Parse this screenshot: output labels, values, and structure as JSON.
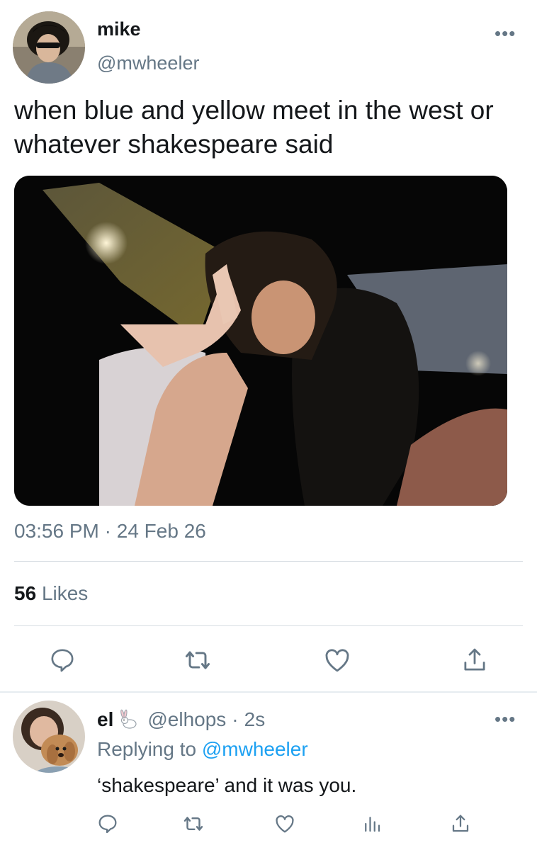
{
  "tweet": {
    "author_name": "mike",
    "author_handle": "@mwheeler",
    "text": "when blue and yellow meet in the west or whatever shakespeare said",
    "time": "03:56 PM",
    "separator": "·",
    "date": "24 Feb 26",
    "likes_count": "56",
    "likes_label": "Likes",
    "more_icon": "more-dots-icon",
    "actions": [
      "reply-icon",
      "retweet-icon",
      "like-icon",
      "share-icon"
    ]
  },
  "reply": {
    "author_name": "el",
    "author_emoji_icon": "rabbit-icon",
    "author_handle": "@elhops",
    "separator": "·",
    "time": "2s",
    "replying_prefix": "Replying to",
    "replying_mention": "@mwheeler",
    "text": "‘shakespeare’ and it was you.",
    "actions": [
      "reply-icon",
      "retweet-icon",
      "like-icon",
      "analytics-icon",
      "share-icon"
    ]
  },
  "colors": {
    "primary_text": "#14171a",
    "secondary_text": "#657786",
    "link": "#1da1f2",
    "divider": "#d8dee3"
  }
}
